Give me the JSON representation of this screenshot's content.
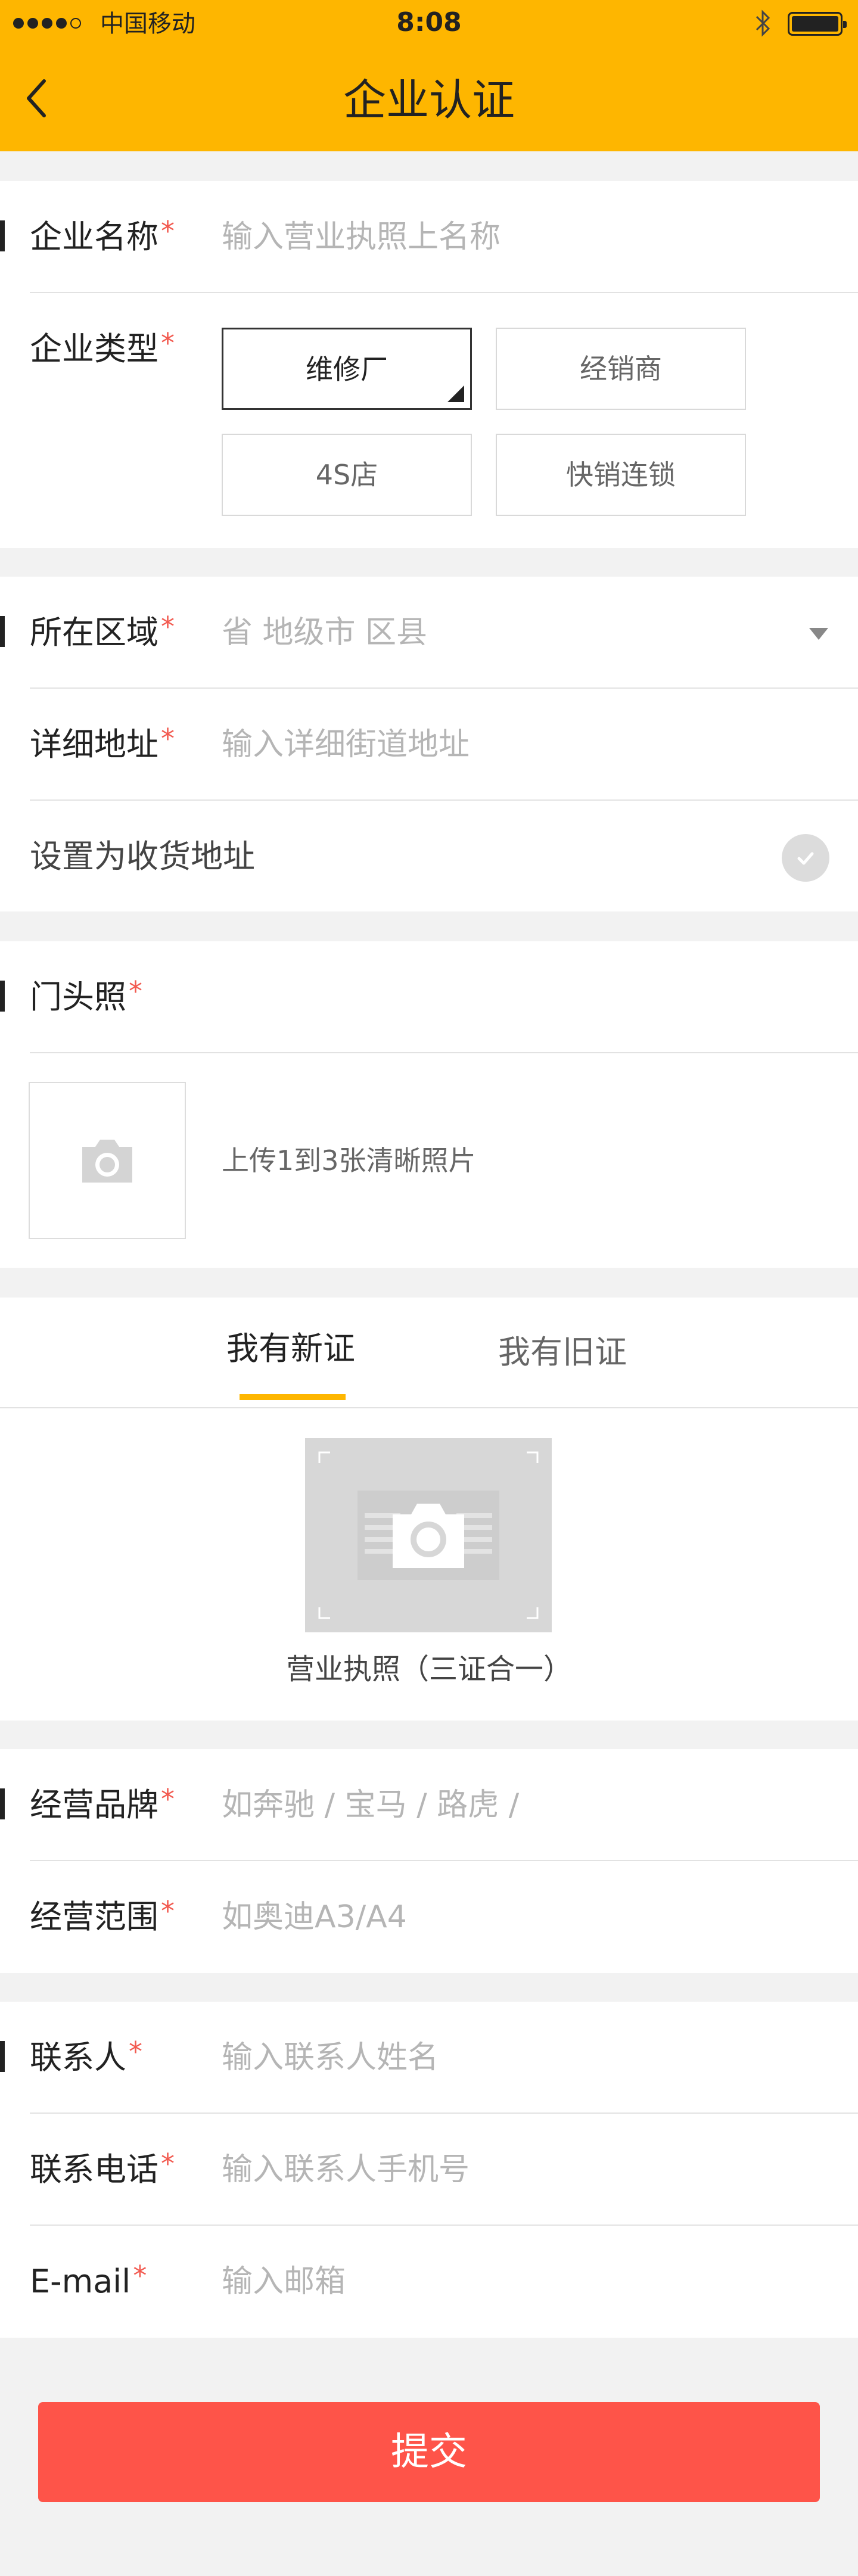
{
  "status_bar": {
    "carrier": "中国移动",
    "time": "8:08"
  },
  "header": {
    "title": "企业认证",
    "back_icon": "chevron-left-icon"
  },
  "company": {
    "name": {
      "label": "企业名称",
      "required": "*",
      "placeholder": "输入营业执照上名称"
    },
    "type": {
      "label": "企业类型",
      "required": "*",
      "options": [
        "维修厂",
        "经销商",
        "4S店",
        "快销连锁"
      ],
      "selected": "维修厂"
    }
  },
  "address": {
    "region": {
      "label": "所在区域",
      "required": "*",
      "placeholder": "省 地级市 区县"
    },
    "detail": {
      "label": "详细地址",
      "required": "*",
      "placeholder": "输入详细街道地址"
    },
    "set_as_shipping": {
      "label": "设置为收货地址",
      "checked": false
    }
  },
  "storefront": {
    "label": "门头照",
    "required": "*",
    "upload_hint": "上传1到3张清晰照片"
  },
  "license": {
    "tabs": [
      {
        "label": "我有新证",
        "active": true
      },
      {
        "label": "我有旧证",
        "active": false
      }
    ],
    "caption": "营业执照（三证合一）"
  },
  "business": {
    "brand": {
      "label": "经营品牌",
      "required": "*",
      "placeholder": "如奔驰 / 宝马 / 路虎 /"
    },
    "scope": {
      "label": "经营范围",
      "required": "*",
      "placeholder": "如奥迪A3/A4"
    }
  },
  "contact": {
    "person": {
      "label": "联系人",
      "required": "*",
      "placeholder": "输入联系人姓名"
    },
    "phone": {
      "label": "联系电话",
      "required": "*",
      "placeholder": "输入联系人手机号"
    },
    "email": {
      "label": "E-mail",
      "required": "*",
      "placeholder": "输入邮箱"
    }
  },
  "submit": {
    "label": "提交"
  },
  "colors": {
    "brand_yellow": "#feb600",
    "submit_red": "#fe5449",
    "required_red": "#f25a50"
  }
}
